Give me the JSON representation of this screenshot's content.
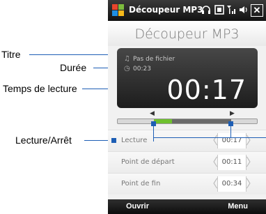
{
  "annotations": {
    "titre": "Titre",
    "duree": "Durée",
    "temps": "Temps de lecture",
    "lecture_arret": "Lecture/Arrêt"
  },
  "statusbar": {
    "app_name": "Découpeur MP3",
    "icons": [
      "headphones-icon",
      "battery-icon",
      "signal-icon",
      "volume-icon"
    ],
    "close": "✕"
  },
  "header": {
    "title": "Découpeur MP3"
  },
  "display": {
    "file_title": "Pas de fichier",
    "duration": "00:23",
    "play_time": "00:17"
  },
  "progress": {
    "played_fraction": 0.13,
    "selection_end_fraction": 0.81
  },
  "rows": [
    {
      "label": "Lecture",
      "value": "00:17"
    },
    {
      "label": "Point de départ",
      "value": "00:11"
    },
    {
      "label": "Point de fin",
      "value": "00:34"
    }
  ],
  "softkeys": {
    "left": "Ouvrir",
    "right": "Menu"
  },
  "colors": {
    "accent": "#1d5eb5",
    "progress": "#6ec02e",
    "screen_bg": "#f1f1f1"
  }
}
